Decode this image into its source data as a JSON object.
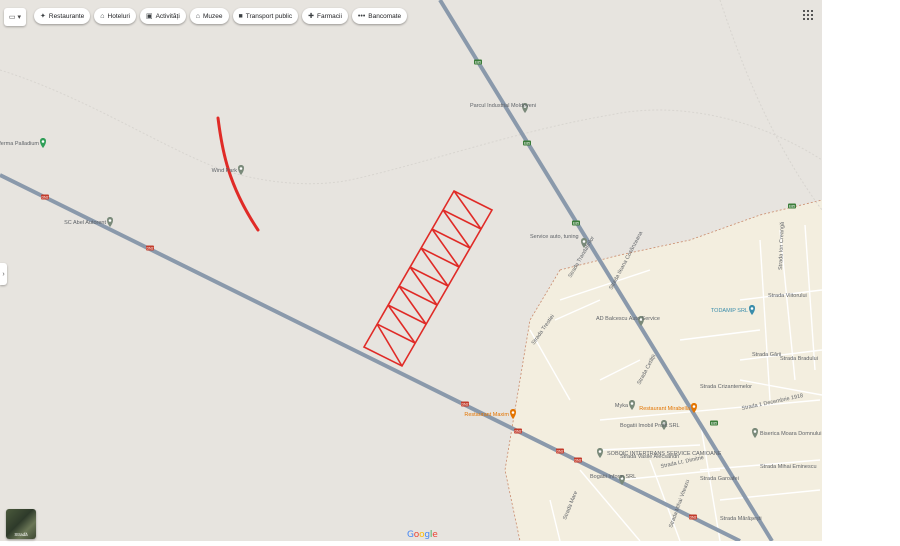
{
  "toolbar": {
    "chips": [
      {
        "icon": "restaurant-icon",
        "glyph": "✦",
        "label": "Restaurante"
      },
      {
        "icon": "bed-icon",
        "glyph": "⌂",
        "label": "Hoteluri"
      },
      {
        "icon": "camera-icon",
        "glyph": "▣",
        "label": "Activități"
      },
      {
        "icon": "museum-icon",
        "glyph": "⌂",
        "label": "Muzee"
      },
      {
        "icon": "bus-icon",
        "glyph": "■",
        "label": "Transport public"
      },
      {
        "icon": "pharmacy-icon",
        "glyph": "✚",
        "label": "Farmacii"
      },
      {
        "icon": "ellipsis-icon",
        "glyph": "•••",
        "label": "Bancomate"
      }
    ]
  },
  "map": {
    "places": [
      {
        "name": "Parcul Industrial Moldoveni",
        "color": "#7a8a7a"
      },
      {
        "name": "ferma Palladium",
        "color": "#2f9e57"
      },
      {
        "name": "Wind Park",
        "color": "#7a8a7a"
      },
      {
        "name": "SC Abel Autorent",
        "color": "#7a8a7a"
      },
      {
        "name": "Service auto, tuning",
        "color": "#7a8a7a"
      },
      {
        "name": "AD Balcescu Auto Service",
        "color": "#7a8a7a"
      },
      {
        "name": "TODAMIP SRL",
        "color": "#3a8dab"
      },
      {
        "name": "Restaurant Mirabella",
        "color": "#e37400"
      },
      {
        "name": "Biserica Moara Domnului Paraschiva",
        "color": "#7a8a7a"
      },
      {
        "name": "Restaurant Maxim",
        "color": "#e37400"
      },
      {
        "name": "SOBOIC INTERTRANS SERVICE CAMIOANE",
        "color": "#7a8a7a"
      },
      {
        "name": "Myka",
        "color": "#7a8a7a"
      },
      {
        "name": "Bogatii Imobil Profit SRL",
        "color": "#7a8a7a"
      },
      {
        "name": "Bogatii Inform SRL",
        "color": "#7a8a7a"
      }
    ],
    "streets": [
      "Strada Ileana Cosânzeana",
      "Strada Trandafirilor",
      "Strada Trestiei",
      "Strada Cetății",
      "Strada Crizantemelor",
      "Strada Bradului",
      "Strada Ion Creangă",
      "Strada 1 Decembrie 1918",
      "Strada Gării",
      "Strada Mihai Eminescu",
      "Strada Viitorului",
      "Strada Lt. Dimitrie",
      "Strada Garoafei",
      "Strada Vasile Alecsandri",
      "Strada Mare",
      "Strada Mihai Viteazu",
      "Strada Mărășești"
    ],
    "route_badges": [
      "DN2",
      "DN2",
      "DN2",
      "DN2",
      "DN2",
      "DN2",
      "DN2",
      "E85",
      "E85",
      "E85",
      "E85",
      "E85"
    ],
    "colors": {
      "land": "#e7e4df",
      "urban": "#f3eedf",
      "highway": "#8a99ab",
      "annotation": "#e02b27",
      "boundary": "#c98a6b"
    }
  },
  "streetview": {
    "label": "Stradă"
  },
  "logo": {
    "letters": [
      "G",
      "o",
      "o",
      "g",
      "l",
      "e"
    ]
  }
}
